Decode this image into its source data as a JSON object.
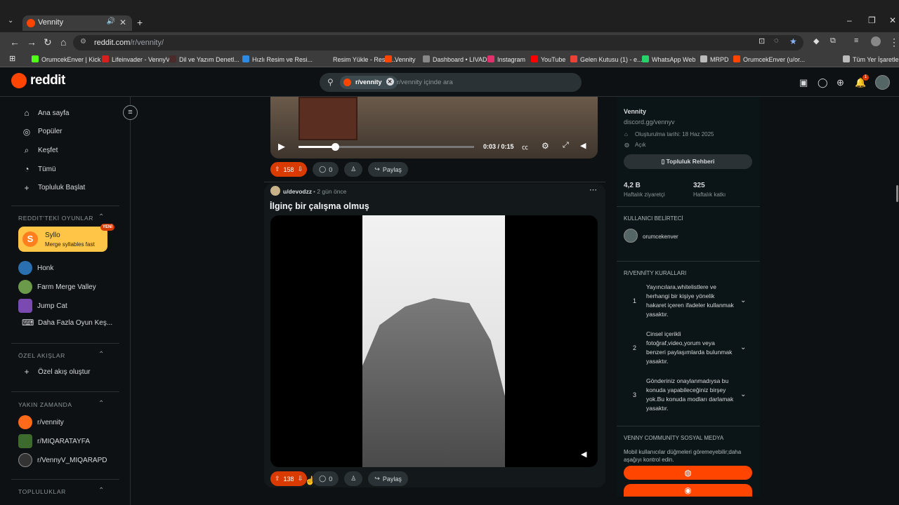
{
  "browser": {
    "tab_title": "Vennity",
    "url_host": "reddit.com",
    "url_path": "/r/vennity/",
    "bookmarks": [
      {
        "label": "OrumcekEnver | Kick",
        "color": "#53fc18"
      },
      {
        "label": "Lifeinvader - VennyV",
        "color": "#d81e1e"
      },
      {
        "label": "Dil ve Yazım Denetl...",
        "color": "#4a2a2a"
      },
      {
        "label": "Hızlı Resim ve Resi...",
        "color": "#2f8ae0"
      },
      {
        "label": "Resim Yükle - Resim...",
        "color": "#3c3c3c"
      },
      {
        "label": "Vennity",
        "color": "#ff4500"
      },
      {
        "label": "Dashboard • LIVAD",
        "color": "#888888"
      },
      {
        "label": "Instagram",
        "color": "#e1306c"
      },
      {
        "label": "YouTube",
        "color": "#ff0000"
      },
      {
        "label": "Gelen Kutusu (1) - e...",
        "color": "#ea4335"
      },
      {
        "label": "WhatsApp Web",
        "color": "#25d366"
      },
      {
        "label": "MRPD",
        "color": "#bbbbbb"
      },
      {
        "label": "OrumcekEnver (u/or...",
        "color": "#ff4500"
      },
      {
        "label": "Tüm Yer İşaretleri",
        "color": "#bbbbbb"
      }
    ]
  },
  "header": {
    "logo_text": "reddit",
    "search_chip": "r/vennity",
    "search_placeholder": "r/vennity içinde ara"
  },
  "sidebar": {
    "main": [
      {
        "label": "Ana sayfa",
        "icon": "home-icon"
      },
      {
        "label": "Popüler",
        "icon": "popular-icon"
      },
      {
        "label": "Keşfet",
        "icon": "explore-icon"
      },
      {
        "label": "Tümü",
        "icon": "all-icon"
      },
      {
        "label": "Topluluk Başlat",
        "icon": "plus-icon"
      }
    ],
    "games_title": "REDDIT'TEKİ OYUNLAR",
    "featured_game": {
      "name": "Syllo",
      "desc": "Merge syllables fast",
      "badge": "YENİ"
    },
    "games": [
      "Honk",
      "Farm Merge Valley",
      "Jump Cat",
      "Daha Fazla Oyun Keş..."
    ],
    "custom_title": "ÖZEL AKIŞLAR",
    "custom_create": "Özel akış oluştur",
    "recent_title": "YAKIN ZAMANDA",
    "recent": [
      "r/vennity",
      "r/MIQARATAYFA",
      "r/VennyV_MIQARAPD"
    ],
    "communities_title": "TOPLULUKLAR"
  },
  "feed": {
    "post1": {
      "time_display": "0:03 / 0:15",
      "votes": "158",
      "comments": "0",
      "share": "Paylaş"
    },
    "post2": {
      "author": "u/devodzz",
      "time": "• 2 gün önce",
      "title": "İlginç bir çalışma olmuş",
      "votes": "138",
      "comments": "0",
      "share": "Paylaş"
    }
  },
  "community": {
    "name": "Vennity",
    "link": "discord.gg/vennyv",
    "created": "Oluşturulma tarihi: 18 Haz 2025",
    "visibility": "Açık",
    "guide_button": "Topluluk Rehberi",
    "stat1_value": "4,2 B",
    "stat1_label": "Haftalık ziyaretçi",
    "stat2_value": "325",
    "stat2_label": "Haftalık katkı",
    "flair_title": "KULLANICI BELİRTECİ",
    "flair_user": "orumcekenver",
    "rules_title": "R/VENNİTY KURALLARI",
    "rules": [
      {
        "num": "1",
        "text": "Yayıncılara,whitelistlere ve herhangi bir kişiye yönelik hakaret içeren ifadeler kullanmak yasaktır."
      },
      {
        "num": "2",
        "text": "Cinsel içerikli fotoğraf,video,yorum veya benzeri paylaşımlarda bulunmak yasaktır."
      },
      {
        "num": "3",
        "text": "Gönderiniz onaylanmadıysa bu konuda yapabileceğiniz birşey yok.Bu konuda modları darlamak yasaktır."
      }
    ],
    "social_title": "VENNY COMMUNİTY SOSYAL MEDYA",
    "social_desc": "Mobil kullanıcılar düğmeleri göremeyebilir;daha aşağıyı kontrol edin."
  },
  "colors": {
    "accent": "#ff4500",
    "vote_bg": "#d93a00"
  }
}
